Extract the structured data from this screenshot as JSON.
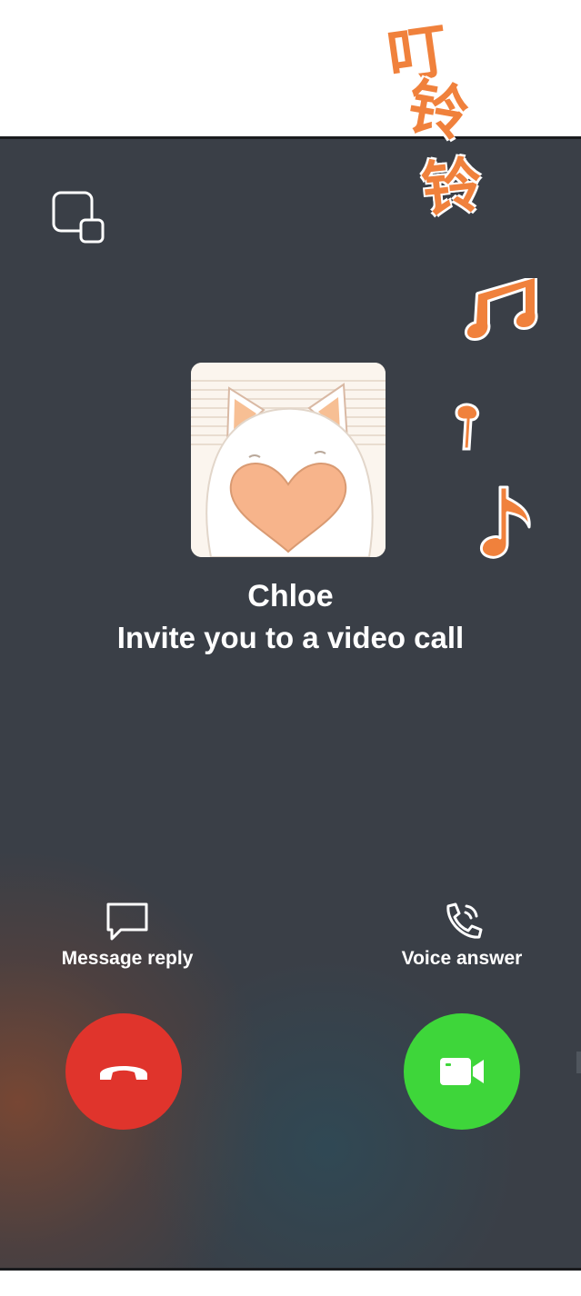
{
  "caller": {
    "name": "Chloe",
    "subtitle": "Invite you to a video call"
  },
  "actions": {
    "message_reply_label": "Message reply",
    "voice_answer_label": "Voice answer"
  },
  "buttons": {
    "decline_icon": "phone-hangup-icon",
    "accept_icon": "video-camera-icon"
  },
  "sound_effect": {
    "chars": [
      "叮",
      "铃",
      "铃"
    ]
  },
  "colors": {
    "background": "#3a3f47",
    "decline": "#e0342c",
    "accept": "#3ed63a",
    "sound_effect": "#f0813c"
  },
  "icons": [
    "floating-window-icon",
    "chat-bubble-icon",
    "phone-icon",
    "music-note-icon"
  ]
}
